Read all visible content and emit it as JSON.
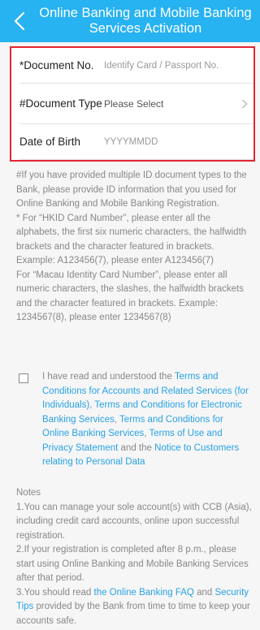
{
  "header": {
    "title": "Online Banking and Mobile Banking Services Activation"
  },
  "form": {
    "document_no": {
      "label": "*Document No.",
      "placeholder": "Identify Card / Passport No."
    },
    "document_type": {
      "label": "#Document Type",
      "value": "Please Select"
    },
    "dob": {
      "label": "Date of Birth",
      "placeholder": "YYYYMMDD"
    }
  },
  "info": {
    "p1": "#If you have provided multiple ID document types to the Bank, please provide ID information that you used for Online Banking and Mobile Banking Registration.",
    "p2": "* For “HKID Card Number”, please enter all the alphabets, the first six numeric characters, the halfwidth brackets and the character featured in brackets. Example: A123456(7), please enter A123456(7)",
    "p3": "For “Macau Identity Card Number”, please enter all numeric characters, the slashes, the halfwidth brackets and the character featured in brackets. Example: 1234567(8), please enter 1234567(8)"
  },
  "terms": {
    "t1": "I have read and understood the ",
    "l1": "Terms and Conditions for Accounts and Related Services (for Individuals)",
    "t2": ", ",
    "l2": "Terms and Conditions for Electronic Banking Services",
    "t3": ", ",
    "l3": "Terms and Conditions for Online Banking Services",
    "t4": ", ",
    "l4": "Terms of Use and Privacy Statement",
    "t5": " and the ",
    "l5": "Notice to Customers relating to Personal Data"
  },
  "notes": {
    "heading": "Notes",
    "n1": "1.You can manage your sole account(s) with CCB (Asia), including credit card accounts, online upon successful registration.",
    "n2": "2.If your registration is completed after 8 p.m., please start using Online Banking and Mobile Banking Services after that period.",
    "n3a": "3.You should read ",
    "n3l1": "the Online Banking FAQ",
    "n3b": " and ",
    "n3l2": "Security Tips",
    "n3c": " provided by the Bank from time to time to keep your accounts safe."
  },
  "colors": {
    "header": "#27b2f1",
    "link": "#27a2e6",
    "highlight_border": "#e22532"
  }
}
